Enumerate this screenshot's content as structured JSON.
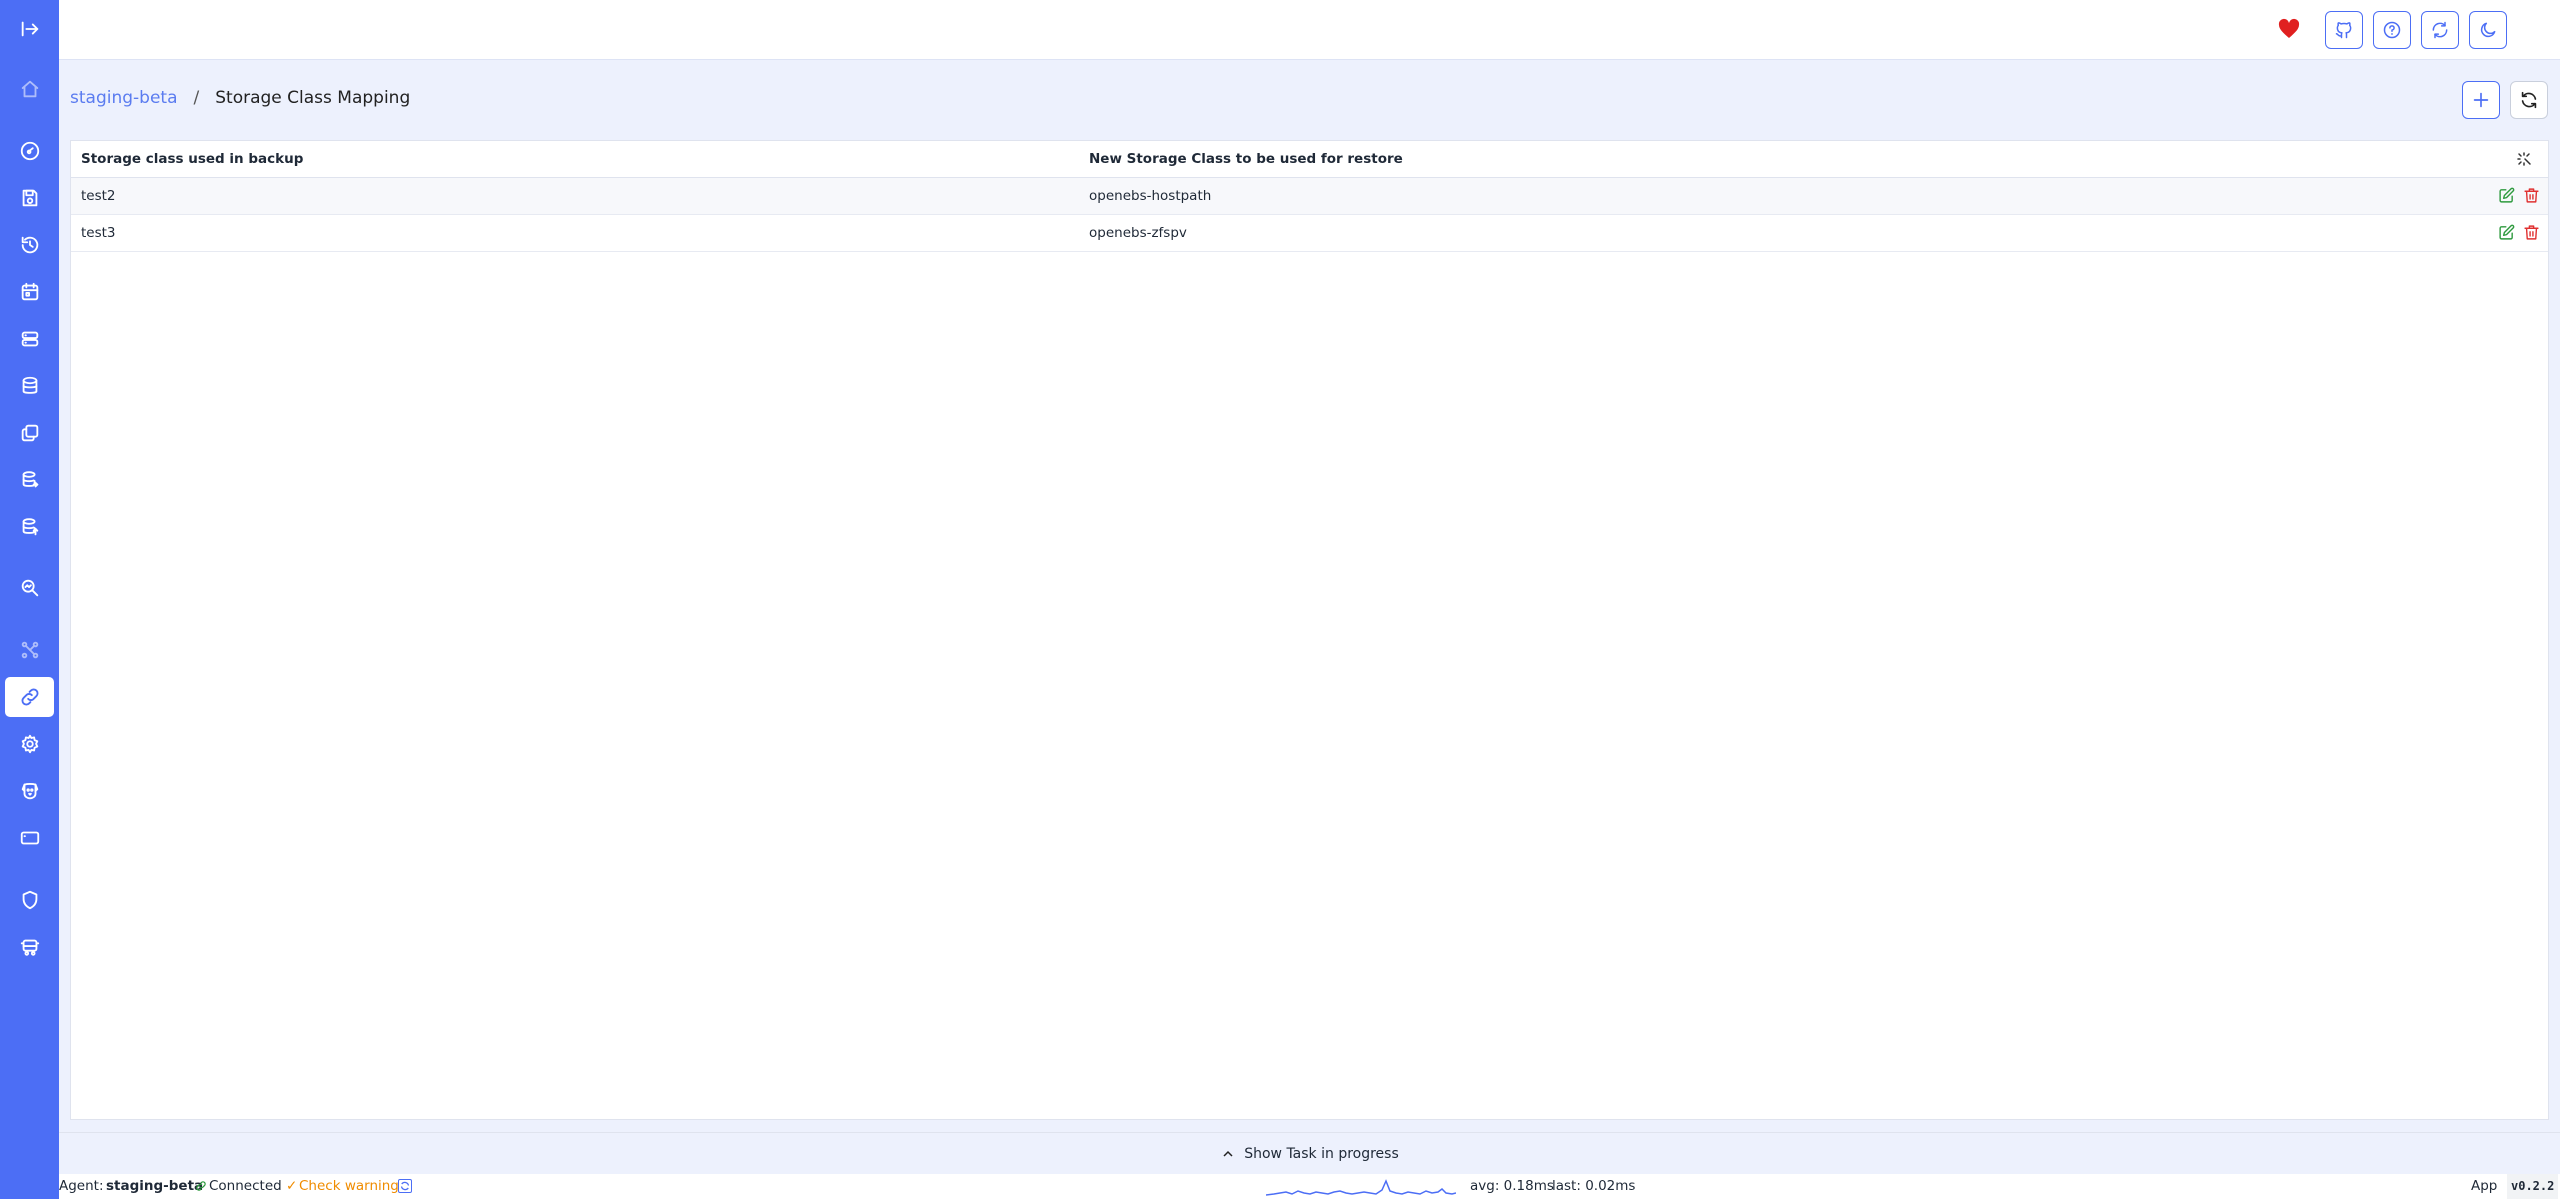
{
  "breadcrumb": {
    "agent": "staging-beta",
    "separator": "/",
    "page": "Storage Class Mapping"
  },
  "table": {
    "headers": [
      "Storage class used in backup",
      "New Storage Class to be used for restore"
    ],
    "rows": [
      {
        "source": "test2",
        "target": "openebs-hostpath"
      },
      {
        "source": "test3",
        "target": "openebs-zfspv"
      }
    ]
  },
  "task_bar": {
    "label": "Show Task in progress"
  },
  "status": {
    "agent_label": "Agent:",
    "agent_name": "staging-beta",
    "connection": "Connected",
    "check": "Check warning",
    "avg": "avg: 0.18ms",
    "last": "last: 0.02ms",
    "app_label": "App",
    "version": "v0.2.2"
  },
  "colors": {
    "sidebar": "#4c6ef5",
    "accent": "#4c6ef5",
    "edit": "#2e9a3e",
    "delete": "#e03131",
    "heart": "#e02020",
    "warning": "#f08c00",
    "success": "#2e9a3e"
  },
  "icons": {
    "sidebar": [
      "collapse-sidebar-icon",
      "home-icon",
      "dashboard-icon",
      "backup-icon",
      "restore-icon",
      "schedule-icon",
      "storage-location-icon",
      "database-icon",
      "snapshot-icon",
      "repository-icon",
      "pvc-icon",
      "inspect-icon",
      "nodes-icon",
      "storage-class-mapping-icon",
      "settings-icon",
      "watchdog-icon",
      "terminal-icon",
      "security-icon",
      "vehicle-icon"
    ],
    "topbar": [
      "heart-icon",
      "github-icon",
      "help-icon",
      "refresh-icon",
      "dark-mode-icon",
      "user-icon"
    ]
  }
}
